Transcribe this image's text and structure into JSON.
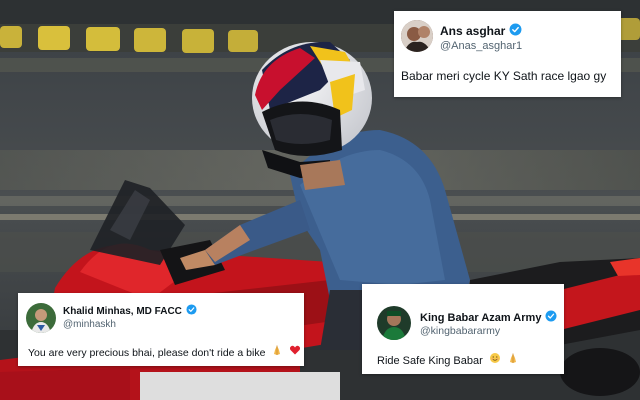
{
  "colors": {
    "verified_badge": "#1d9bf0",
    "text_primary": "#0f1419",
    "text_secondary": "#536471",
    "card_bg": "#ffffff"
  },
  "photo": {
    "subjects": [
      "rider",
      "helmet",
      "shirt",
      "bike"
    ]
  },
  "tweets": [
    {
      "display_name": "Ans asghar",
      "handle": "@Anas_asghar1",
      "verified": true,
      "text": "Babar meri cycle KY Sath race lgao gy",
      "emoji": [],
      "avatar_icon": "profile-avatar"
    },
    {
      "display_name": "Khalid Minhas, MD FACC",
      "handle": "@minhaskh",
      "verified": true,
      "text": "You are very precious bhai, please don't ride a bike",
      "emoji": [
        "folded-hands-icon",
        "red-heart-icon"
      ],
      "avatar_icon": "profile-avatar"
    },
    {
      "display_name": "King Babar Azam Army",
      "handle": "@kingbabararmy",
      "verified": true,
      "text": "Ride Safe King Babar",
      "emoji": [
        "smiling-face-icon",
        "folded-hands-icon"
      ],
      "avatar_icon": "profile-avatar"
    }
  ]
}
